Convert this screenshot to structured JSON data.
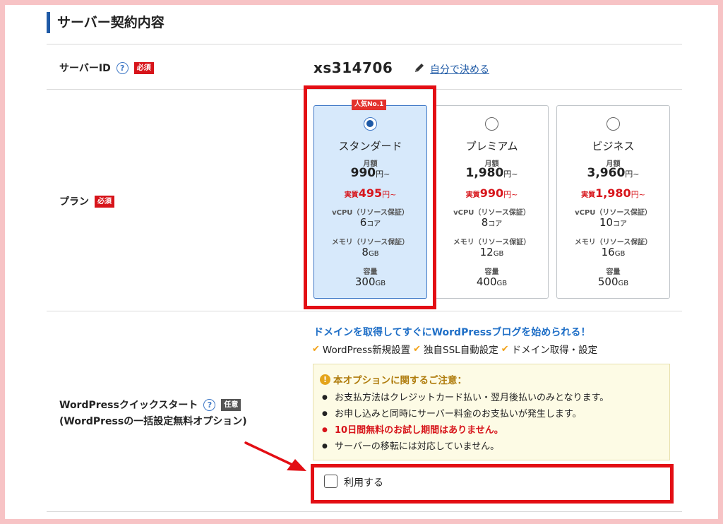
{
  "section_title": "サーバー契約内容",
  "server_id": {
    "label": "サーバーID",
    "help_icon": "question-circle-icon",
    "required_badge": "必須",
    "value": "xs314706",
    "edit_icon": "pencil-icon",
    "self_link": "自分で決める"
  },
  "plan": {
    "label": "プラン",
    "required_badge": "必須",
    "popular_badge": "人気No.1",
    "selected_index": 0,
    "cards": [
      {
        "name": "スタンダード",
        "monthly_label": "月額",
        "price": "990",
        "price_unit": "円~",
        "effective_prefix": "実質",
        "effective_price": "495",
        "effective_unit": "円~",
        "cpu_label": "vCPU（リソース保証）",
        "cpu_value": "6",
        "cpu_unit": "コア",
        "mem_label": "メモリ（リソース保証）",
        "mem_value": "8",
        "mem_unit": "GB",
        "disk_label": "容量",
        "disk_value": "300",
        "disk_unit": "GB"
      },
      {
        "name": "プレミアム",
        "monthly_label": "月額",
        "price": "1,980",
        "price_unit": "円~",
        "effective_prefix": "実質",
        "effective_price": "990",
        "effective_unit": "円~",
        "cpu_label": "vCPU（リソース保証）",
        "cpu_value": "8",
        "cpu_unit": "コア",
        "mem_label": "メモリ（リソース保証）",
        "mem_value": "12",
        "mem_unit": "GB",
        "disk_label": "容量",
        "disk_value": "400",
        "disk_unit": "GB"
      },
      {
        "name": "ビジネス",
        "monthly_label": "月額",
        "price": "3,960",
        "price_unit": "円~",
        "effective_prefix": "実質",
        "effective_price": "1,980",
        "effective_unit": "円~",
        "cpu_label": "vCPU（リソース保証）",
        "cpu_value": "10",
        "cpu_unit": "コア",
        "mem_label": "メモリ（リソース保証）",
        "mem_value": "16",
        "mem_unit": "GB",
        "disk_label": "容量",
        "disk_value": "500",
        "disk_unit": "GB"
      }
    ]
  },
  "quickstart": {
    "label_line1": "WordPressクイックスタート",
    "label_line2": "(WordPressの一括設定無料オプション)",
    "optional_badge": "任意",
    "headline": "ドメインを取得してすぐにWordPressブログを始められる！",
    "features": [
      "WordPress新規設置",
      "独自SSL自動設定",
      "ドメイン取得・設定"
    ],
    "notice_title": "本オプションに関するご注意：",
    "notice_items": [
      "お支払方法はクレジットカード払い・翌月後払いのみとなります。",
      "お申し込みと同時にサーバー料金のお支払いが発生します。",
      "10日間無料のお試し期間はありません。",
      "サーバーの移転には対応していません。"
    ],
    "checkbox_label": "利用する",
    "checkbox_checked": false
  },
  "colors": {
    "accent_blue": "#1f5aa6",
    "highlight_red": "#e30e14",
    "selected_card_bg": "#d7e9fb",
    "frame_pink": "#f7c3c5"
  }
}
